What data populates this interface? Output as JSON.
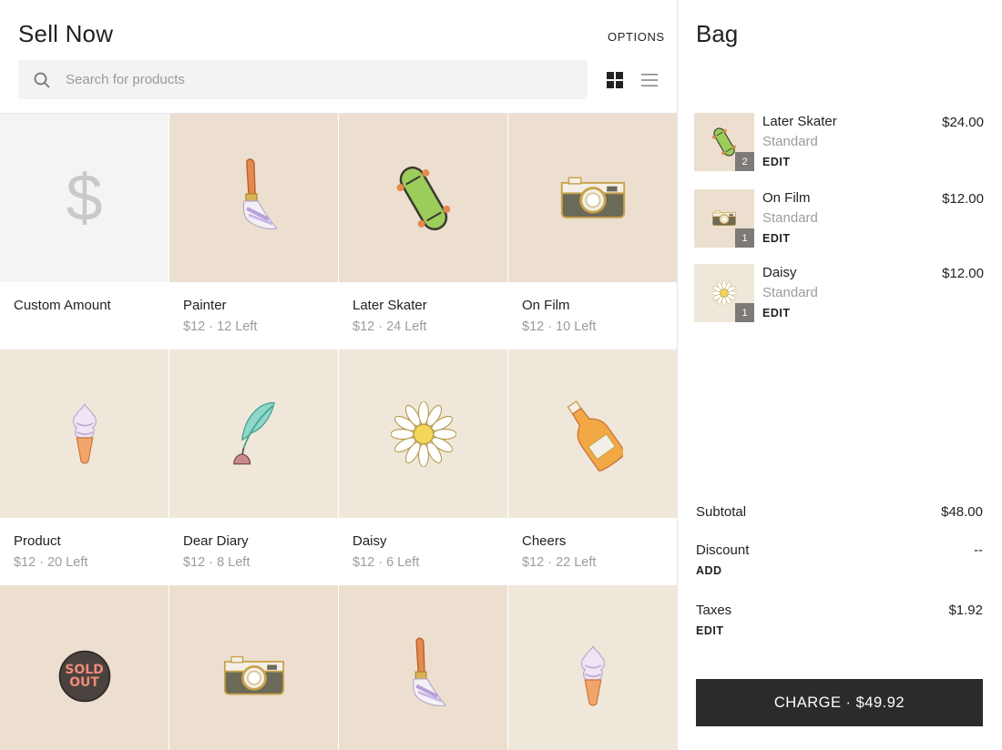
{
  "header": {
    "title": "Sell Now",
    "options_label": "OPTIONS",
    "search_placeholder": "Search for products"
  },
  "products": [
    {
      "name": "Custom Amount",
      "meta": "",
      "icon": "dollar-sign-icon",
      "bg": "plain"
    },
    {
      "name": "Painter",
      "meta": "$12 · 12 Left",
      "icon": "paintbrush-pin-icon",
      "bg": "tan"
    },
    {
      "name": "Later Skater",
      "meta": "$12 · 24 Left",
      "icon": "skateboard-pin-icon",
      "bg": "tan"
    },
    {
      "name": "On Film",
      "meta": "$12 · 10 Left",
      "icon": "camera-pin-icon",
      "bg": "tan"
    },
    {
      "name": "Product",
      "meta": "$12 · 20 Left",
      "icon": "ice-cream-pin-icon",
      "bg": "cream"
    },
    {
      "name": "Dear Diary",
      "meta": "$12 · 8 Left",
      "icon": "quill-pin-icon",
      "bg": "cream"
    },
    {
      "name": "Daisy",
      "meta": "$12 · 6 Left",
      "icon": "daisy-pin-icon",
      "bg": "cream"
    },
    {
      "name": "Cheers",
      "meta": "$12 · 22 Left",
      "icon": "bottle-pin-icon",
      "bg": "cream"
    },
    {
      "name": "",
      "meta": "",
      "icon": "sold-out-pin-icon",
      "bg": "tan",
      "badge_line1": "SOLD",
      "badge_line2": "OUT"
    },
    {
      "name": "",
      "meta": "",
      "icon": "camera-pin-icon",
      "bg": "tan"
    },
    {
      "name": "",
      "meta": "",
      "icon": "paintbrush-pin-icon",
      "bg": "tan"
    },
    {
      "name": "",
      "meta": "",
      "icon": "ice-cream-pin-icon",
      "bg": "cream"
    }
  ],
  "bag": {
    "title": "Bag",
    "items": [
      {
        "name": "Later Skater",
        "variant": "Standard",
        "edit": "EDIT",
        "price": "$24.00",
        "qty": "2",
        "icon": "skateboard-pin-icon"
      },
      {
        "name": "On Film",
        "variant": "Standard",
        "edit": "EDIT",
        "price": "$12.00",
        "qty": "1",
        "icon": "camera-pin-icon"
      },
      {
        "name": "Daisy",
        "variant": "Standard",
        "edit": "EDIT",
        "price": "$12.00",
        "qty": "1",
        "icon": "daisy-pin-icon"
      }
    ],
    "subtotal_label": "Subtotal",
    "subtotal_value": "$48.00",
    "discount_label": "Discount",
    "discount_value": "--",
    "discount_action": "ADD",
    "taxes_label": "Taxes",
    "taxes_value": "$1.92",
    "taxes_action": "EDIT",
    "charge_label": "CHARGE · $49.92"
  },
  "colors": {
    "tile_tan": "#ecdfd0",
    "tile_cream": "#efe8da",
    "charge_button": "#2b2b2b"
  }
}
